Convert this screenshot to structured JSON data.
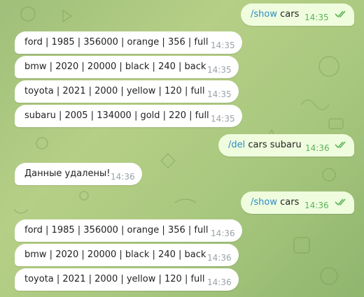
{
  "chat": {
    "messages": [
      {
        "dir": "out",
        "command": "/show",
        "text": " cars",
        "time": "14:35",
        "status": "double-check-icon"
      },
      {
        "dir": "in",
        "text": "ford | 1985 | 356000 | orange | 356 | full",
        "time": "14:35"
      },
      {
        "dir": "in",
        "text": "bmw | 2020 | 20000 | black | 240 | back",
        "time": "14:35"
      },
      {
        "dir": "in",
        "text": "toyota | 2021 | 2000 | yellow | 120 | full",
        "time": "14:35"
      },
      {
        "dir": "in",
        "text": "subaru | 2005 | 134000 | gold | 220 | full",
        "time": "14:35"
      },
      {
        "dir": "out",
        "command": "/del",
        "text": " cars subaru",
        "time": "14:36",
        "status": "double-check-icon"
      },
      {
        "dir": "in",
        "text": "Данные удалены!",
        "time": "14:36"
      },
      {
        "dir": "out",
        "command": "/show",
        "text": " cars",
        "time": "14:36",
        "status": "double-check-icon"
      },
      {
        "dir": "in",
        "text": "ford | 1985 | 356000 | orange | 356 | full",
        "time": "14:36"
      },
      {
        "dir": "in",
        "text": "bmw | 2020 | 20000 | black | 240 | back",
        "time": "14:36"
      },
      {
        "dir": "in",
        "text": "toyota | 2021 | 2000 | yellow | 120 | full",
        "time": "14:36"
      }
    ]
  },
  "colors": {
    "incoming_bubble": "#ffffff",
    "outgoing_bubble": "#effdde",
    "command_link": "#2f8ac4",
    "read_check": "#5db25a"
  }
}
